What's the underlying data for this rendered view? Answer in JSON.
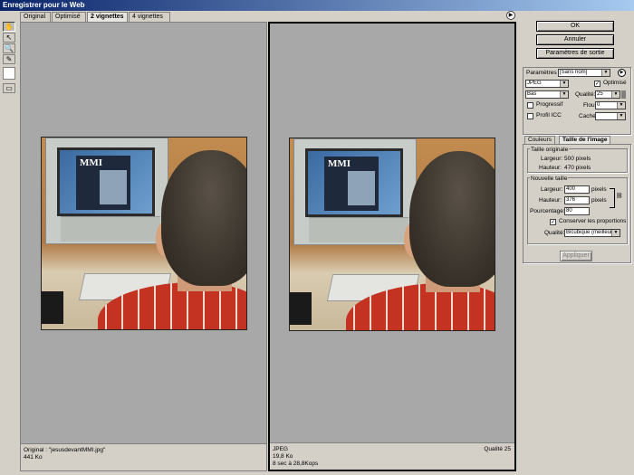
{
  "window": {
    "title": "Enregistrer pour le Web"
  },
  "tabs": [
    {
      "label": "Original"
    },
    {
      "label": "Optimisé"
    },
    {
      "label": "2 vignettes"
    },
    {
      "label": "4 vignettes"
    }
  ],
  "tools": [
    "hand-icon",
    "slice-select-icon",
    "zoom-icon",
    "eyedropper-icon",
    "color-swatch-icon",
    "toggle-slices-icon"
  ],
  "panes": {
    "left": {
      "line1": "Original : \"jesusdevantMMI.jpg\"",
      "line2": "441 Ko"
    },
    "right": {
      "line1": "JPEG",
      "line2": "19,8 Ko",
      "line3": "8 sec à 28,8Kops",
      "quality": "Qualité 25"
    }
  },
  "photo": {
    "screen_text": "MMI"
  },
  "buttons": {
    "ok": "OK",
    "cancel": "Annuler",
    "output": "Paramètres de sortie",
    "apply": "Appliquer"
  },
  "settings": {
    "params_label": "Paramètres :",
    "params_value": "[Sans nom]",
    "format": "JPEG",
    "optimized_label": "Optimisé",
    "quality_preset": "Bas",
    "quality_label": "Qualité:",
    "quality_value": "25",
    "progressive_label": "Progressif",
    "blur_label": "Flou:",
    "blur_value": "0",
    "icc_label": "Profil ICC",
    "matte_label": "Cache:"
  },
  "panel_tabs": {
    "colors": "Couleurs",
    "image_size": "Taille de l'image"
  },
  "image_size": {
    "original_title": "Taille originale",
    "width_label": "Largeur:",
    "width_value": "500 pixels",
    "height_label": "Hauteur:",
    "height_value": "470 pixels",
    "new_title": "Nouvelle taille",
    "new_width_label": "Largeur:",
    "new_width_value": "400",
    "new_height_label": "Hauteur:",
    "new_height_value": "376",
    "unit": "pixels",
    "percent_label": "Pourcentage:",
    "percent_value": "80",
    "constrain_label": "Conserver les proportions",
    "quality_label": "Qualité:",
    "quality_value": "Bicubique (meilleur..."
  }
}
